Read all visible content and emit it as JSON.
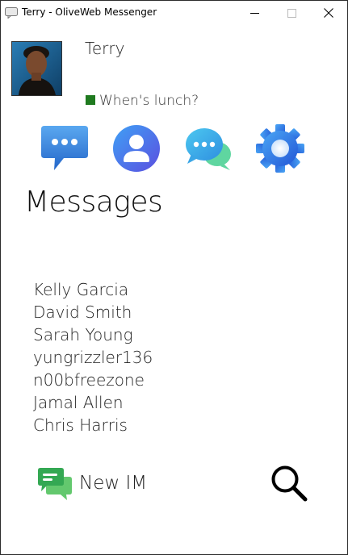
{
  "window": {
    "title": "Terry - OliveWeb Messenger"
  },
  "profile": {
    "name": "Terry",
    "status_message": "When's lunch?",
    "status_color": "#1f7a1f"
  },
  "nav": {
    "items": [
      {
        "icon": "messages-icon"
      },
      {
        "icon": "contacts-icon"
      },
      {
        "icon": "chats-icon"
      },
      {
        "icon": "settings-icon"
      }
    ]
  },
  "main": {
    "heading": "Messages",
    "contacts": [
      "Kelly Garcia",
      "David Smith",
      "Sarah Young",
      "yungrizzler136",
      "n00bfreezone",
      "Jamal Allen",
      "Chris Harris"
    ]
  },
  "actions": {
    "new_im_label": "New IM",
    "search_icon": "search-icon"
  },
  "colors": {
    "accent_blue": "#2f7de1",
    "accent_green": "#3fbf5f"
  }
}
